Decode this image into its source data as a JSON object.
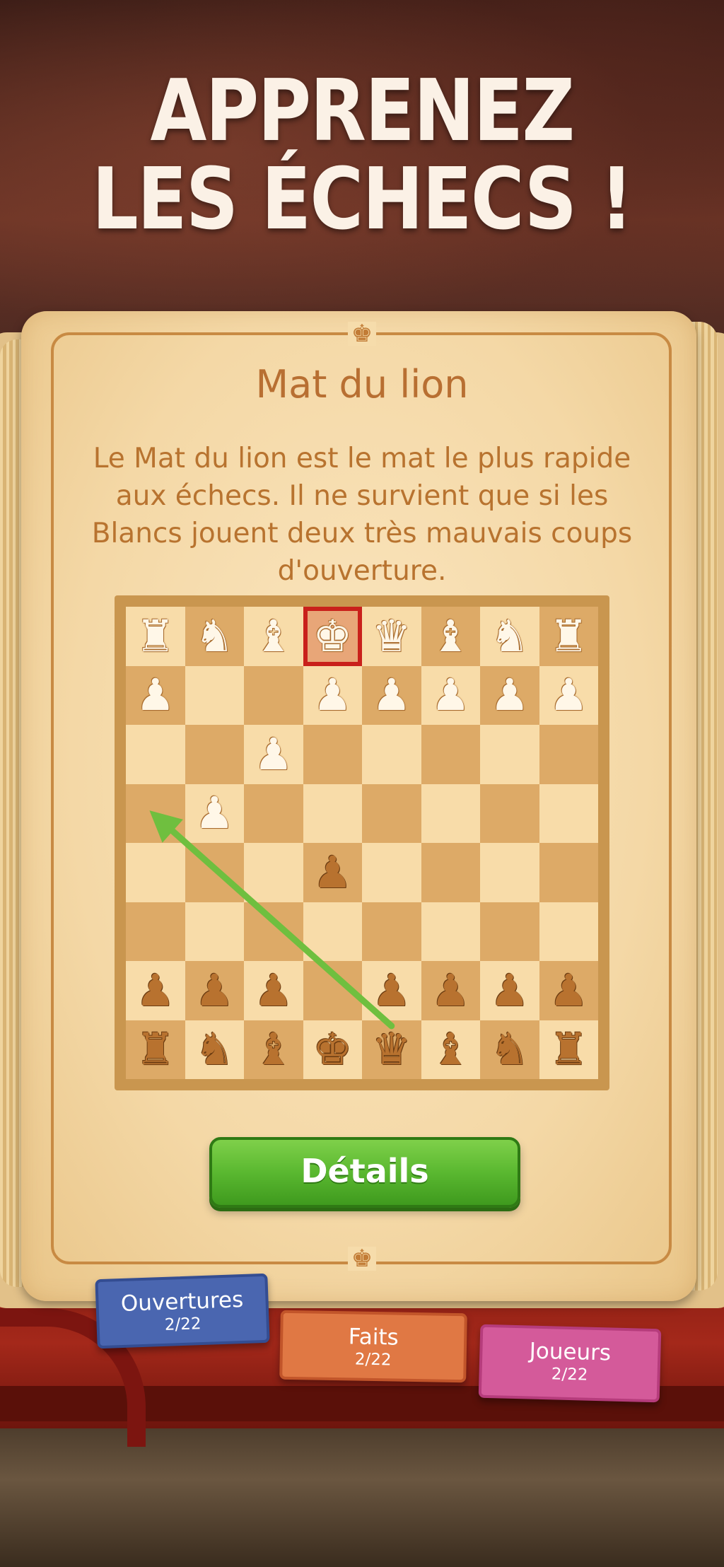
{
  "headline": {
    "line1": "APPRENEZ",
    "line2": "LES ÉCHECS !"
  },
  "card": {
    "title": "Mat du lion",
    "description": "Le Mat du lion est le mat le plus rapide aux échecs. Il ne survient que si les Blancs jouent deux très mauvais coups d'ouverture."
  },
  "board": {
    "ranks": [
      [
        "wR",
        "wN",
        "wB",
        "wK",
        "wQ",
        "wB",
        "wN",
        "wR"
      ],
      [
        "wP",
        "",
        "",
        "wP",
        "wP",
        "wP",
        "wP",
        "wP"
      ],
      [
        "",
        "",
        "wP",
        "",
        "",
        "",
        "",
        ""
      ],
      [
        "",
        "wP",
        "",
        "",
        "",
        "",
        "",
        ""
      ],
      [
        "",
        "",
        "",
        "bP",
        "",
        "",
        "",
        ""
      ],
      [
        "",
        "",
        "",
        "",
        "",
        "",
        "",
        ""
      ],
      [
        "bP",
        "bP",
        "bP",
        "",
        "bP",
        "bP",
        "bP",
        "bP"
      ],
      [
        "bR",
        "bN",
        "bB",
        "bK",
        "bQ",
        "bB",
        "bN",
        "bR"
      ]
    ],
    "highlight": {
      "row": 0,
      "col": 3
    },
    "highlight_color": "#c9201b",
    "arrow": {
      "from": {
        "row": 7,
        "col": 4
      },
      "to": {
        "row": 3,
        "col": 0
      },
      "color": "#6fbf3f"
    }
  },
  "details_button": {
    "label": "Détails"
  },
  "tabs": [
    {
      "label": "Ouvertures",
      "progress": "2/22",
      "color": "#4a66b0"
    },
    {
      "label": "Faits",
      "progress": "2/22",
      "color": "#e07844"
    },
    {
      "label": "Joueurs",
      "progress": "2/22",
      "color": "#d45a9a"
    }
  ]
}
